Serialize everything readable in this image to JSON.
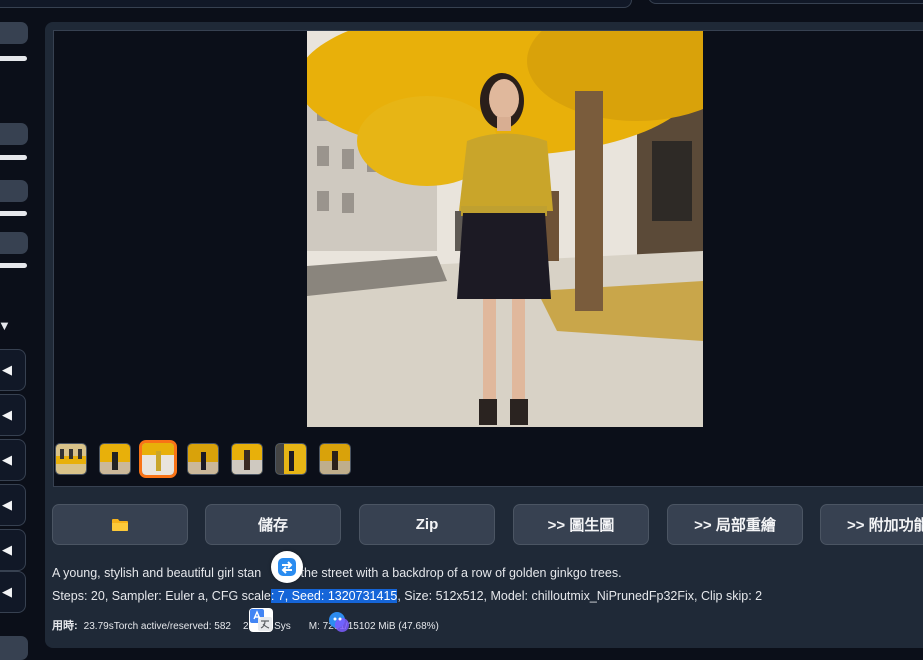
{
  "toolbar": {
    "folder_icon": "folder-icon",
    "save_label": "儲存",
    "zip_label": "Zip",
    "img2img_label": ">> 圖生圖",
    "inpaint_label": ">> 局部重繪",
    "extras_label": ">> 附加功能"
  },
  "info": {
    "prompt_before": "A young, stylish and beautiful girl stan",
    "prompt_after": "on the street with a backdrop of a row of golden ginkgo trees.",
    "params_before": "Steps: 20, Sampler: Euler a, CFG scale",
    "params_selected": ": 7, Seed: 1320731415",
    "params_after": ", Size: 512x512, Model: chilloutmix_NiPrunedFp32Fix, Clip skip: 2",
    "time_label": "用時:",
    "time_before": "23.79sTorch active/reserved: 582",
    "time_middle": "2 MiB, Sys",
    "time_after": "M: 7201/15102 MiB (47.68%)"
  },
  "colors": {
    "background": "#0b0f19",
    "panel": "#1f2937",
    "button": "#374151",
    "selected_thumb": "#f97316",
    "text_highlight": "#1565d8",
    "ginkgo": "#e8b00a"
  },
  "icons": {
    "collapse": "triangle-down-icon",
    "expand": "triangle-left-icon",
    "translate_float": "translate-swap-icon",
    "google_translate": "google-translate-icon",
    "ai_assistant": "ai-assistant-icon"
  }
}
